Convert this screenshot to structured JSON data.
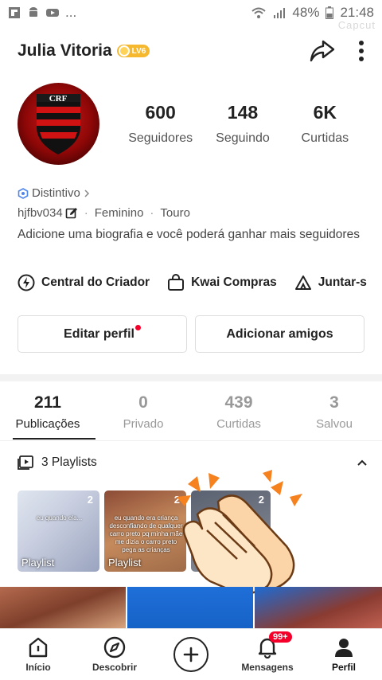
{
  "status_bar": {
    "left_icons": [
      "flipboard-icon",
      "android-icon",
      "youtube-icon"
    ],
    "ellipsis": "...",
    "battery": "48%",
    "time": "21:48",
    "watermark": "Capcut"
  },
  "header": {
    "name": "Julia Vitoria",
    "level": "LV6",
    "share_icon": "share-icon",
    "more_icon": "more-vertical-icon"
  },
  "stats": [
    {
      "value": "600",
      "label": "Seguidores"
    },
    {
      "value": "148",
      "label": "Seguindo"
    },
    {
      "value": "6K",
      "label": "Curtidas"
    }
  ],
  "profile": {
    "distintivo": "Distintivo",
    "username": "hjfbv034",
    "gender": "Feminino",
    "sign": "Touro",
    "bio": "Adicione uma biografia e você poderá ganhar mais seguidores"
  },
  "shortcuts": [
    {
      "label": "Central do Criador",
      "icon": "lightning-icon"
    },
    {
      "label": "Kwai Compras",
      "icon": "shopping-bag-icon"
    },
    {
      "label": "Juntar-s",
      "icon": "tent-icon"
    }
  ],
  "buttons": {
    "edit": "Editar perfil",
    "add": "Adicionar amigos"
  },
  "tabs": [
    {
      "count": "211",
      "label": "Publicações",
      "active": true
    },
    {
      "count": "0",
      "label": "Privado",
      "active": false
    },
    {
      "count": "439",
      "label": "Curtidas",
      "active": false
    },
    {
      "count": "3",
      "label": "Salvou",
      "active": false
    }
  ],
  "playlists": {
    "title": "3 Playlists",
    "items": [
      {
        "label": "Playlist",
        "count": "2",
        "caption": "eu quando ela..."
      },
      {
        "label": "Playlist",
        "count": "2",
        "caption": "eu quando era criança desconfiando de qualquer carro preto pq minha mãe me dizia o carro preto pega as crianças"
      },
      {
        "label": "",
        "count": "2",
        "caption": ""
      }
    ]
  },
  "bottom_nav": [
    {
      "label": "Início",
      "icon": "home-icon"
    },
    {
      "label": "Descobrir",
      "icon": "compass-icon"
    },
    {
      "label": "",
      "icon": "plus-icon"
    },
    {
      "label": "Mensagens",
      "icon": "bell-icon",
      "badge": "99+"
    },
    {
      "label": "Perfil",
      "icon": "person-icon",
      "active": true
    }
  ],
  "colors": {
    "accent_red": "#f4002a",
    "badge_gold": "#f5b82e",
    "text_dark": "#222222",
    "text_muted": "#999999"
  }
}
